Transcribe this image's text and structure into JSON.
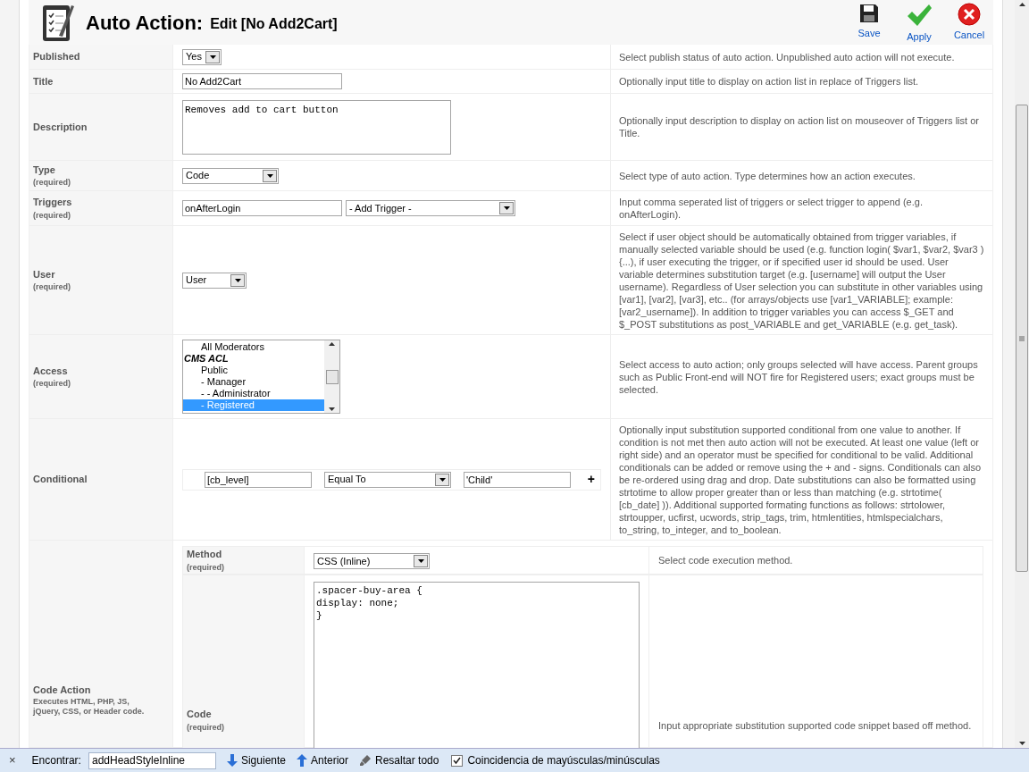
{
  "header": {
    "title": "Auto Action:",
    "subtitle": "Edit [No Add2Cart]"
  },
  "toolbar": [
    {
      "label": "Save",
      "kind": "save"
    },
    {
      "label": "Apply",
      "kind": "apply"
    },
    {
      "label": "Cancel",
      "kind": "cancel"
    }
  ],
  "rows": [
    {
      "kind": "select",
      "label": "Published",
      "value": "Yes",
      "description": "Select publish status of auto action. Unpublished auto action will not execute."
    },
    {
      "kind": "text",
      "label": "Title",
      "value": "No Add2Cart",
      "description": "Optionally input title to display on action list in replace of Triggers list."
    },
    {
      "kind": "textarea",
      "label": "Description",
      "value": "Removes add to cart button",
      "description": "Optionally input description to display on action list on mouseover of Triggers list or Title."
    },
    {
      "kind": "select",
      "label": "Type",
      "note": "(required)",
      "value": "Code",
      "description": "Select type of auto action. Type determines how an action executes."
    },
    {
      "kind": "trigger",
      "label": "Triggers",
      "note": "(required)",
      "value": "onAfterLogin",
      "select": "- Add Trigger -",
      "description": "Input comma seperated list of triggers or select trigger to append (e.g. onAfterLogin)."
    },
    {
      "kind": "select",
      "label": "User",
      "note": "(required)",
      "value": "User",
      "description": "Select if user object should be automatically obtained from trigger variables, if manually selected variable should be used (e.g. function login( $var1, $var2, $var3 ) {...), if user executing the trigger, or if specified user id should be used. User variable determines substitution target (e.g. [username] will output the User username). Regardless of User selection you can substitute in other variables using [var1], [var2], [var3], etc.. (for arrays/objects use [var1_VARIABLE]; example: [var2_username]). In addition to trigger variables you can access $_GET and $_POST substitutions as post_VARIABLE and get_VARIABLE (e.g. get_task)."
    },
    {
      "kind": "listbox",
      "label": "Access",
      "note": "(required)",
      "options": [
        {
          "label": "All Moderators",
          "kind": "option",
          "selected": false
        },
        {
          "label": "CMS ACL",
          "kind": "group",
          "selected": false
        },
        {
          "label": "Public",
          "kind": "option",
          "selected": false
        },
        {
          "label": "- Manager",
          "kind": "option",
          "selected": false
        },
        {
          "label": "- - Administrator",
          "kind": "option",
          "selected": false
        },
        {
          "label": "- Registered",
          "kind": "option",
          "selected": true
        }
      ],
      "description": "Select access to auto action; only groups selected will have access. Parent groups such as Public Front-end will NOT fire for Registered users; exact groups must be selected."
    },
    {
      "kind": "conditional",
      "label": "Conditional",
      "left": "[cb_level]",
      "operator": "Equal To",
      "right": "'Child'",
      "add": "+",
      "description": "Optionally input substitution supported conditional from one value to another. If condition is not met then auto action will not be executed. At least one value (left or right side) and an operator must be specified for conditional to be valid. Additional conditionals can be added or remove using the + and - signs. Conditionals can also be re-ordered using drag and drop. Date substitutions can also be formatted using strtotime to allow proper greater than or less than matching (e.g. strtotime( [cb_date] )). Additional supported formating functions as follows: strtolower, strtoupper, ucfirst, ucwords, strip_tags, trim, htmlentities, htmlspecialchars, to_string, to_integer, and to_boolean."
    },
    {
      "kind": "code",
      "label": "Code Action",
      "note": "Executes HTML, PHP, JS, jQuery, CSS, or Header code.",
      "subrows": [
        {
          "kind": "select",
          "label": "Method",
          "note": "(required)",
          "value": "CSS (Inline)",
          "description": "Select code execution method."
        },
        {
          "kind": "codearea",
          "label": "Code",
          "note": "(required)",
          "value": ".spacer-buy-area {\ndisplay: none;\n}",
          "description": "Input appropriate substitution supported code snippet based off method."
        }
      ]
    }
  ],
  "find_bar": {
    "close": "×",
    "label": "Encontrar:",
    "query": "addHeadStyleInline",
    "buttons": [
      {
        "label": "Siguiente",
        "kind": "next"
      },
      {
        "label": "Anterior",
        "kind": "prev"
      },
      {
        "label": "Resaltar todo",
        "kind": "highlight"
      }
    ],
    "match_case": {
      "label": "Coincidencia de mayúsculas/minúsculas",
      "checked": true
    }
  }
}
